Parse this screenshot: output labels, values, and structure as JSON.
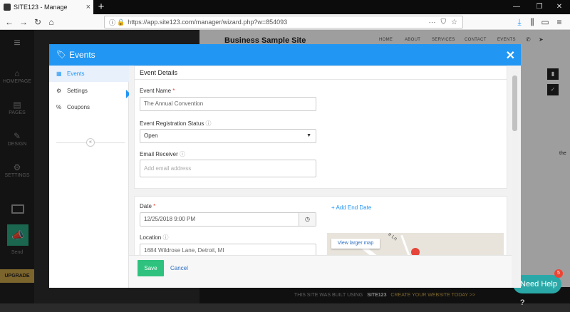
{
  "browser": {
    "tab_title": "SITE123 - Manage",
    "tab_close": "×",
    "new_tab": "+",
    "url": "https://app.site123.com/manager/wizard.php?w=854093",
    "url_menu": "···",
    "window_controls": [
      "—",
      "❐",
      "✕"
    ]
  },
  "leftnav": {
    "items": [
      {
        "label": "HOMEPAGE",
        "icon": "home-icon"
      },
      {
        "label": "PAGES",
        "icon": "pages-icon"
      },
      {
        "label": "DESIGN",
        "icon": "design-icon"
      },
      {
        "label": "SETTINGS",
        "icon": "settings-icon"
      }
    ],
    "send_label": "Send",
    "upgrade_label": "UPGRADE"
  },
  "site_preview": {
    "title": "Business Sample Site",
    "nav": [
      "HOME",
      "ABOUT",
      "SERVICES",
      "CONTACT",
      "EVENTS"
    ],
    "bottom_text": "THIS SITE WAS BUILT USING",
    "brand": "SITE123",
    "cta": "CREATE YOUR WEBSITE TODAY >>",
    "the_snippet": "the"
  },
  "help_widget": {
    "label": "Need Help ?",
    "badge": "5"
  },
  "modal": {
    "title": "Events",
    "close": "✕",
    "sidebar": [
      {
        "label": "Events",
        "icon": "tag-icon",
        "active": true
      },
      {
        "label": "Settings",
        "icon": "gear-icon",
        "active": false
      },
      {
        "label": "Coupons",
        "icon": "percent-icon",
        "active": false
      }
    ],
    "collapse_glyph": "«",
    "details": {
      "heading": "Event Details",
      "event_name_label": "Event Name",
      "event_name_value": "The Annual Convention",
      "status_label": "Event Registration Status",
      "status_value": "Open",
      "email_label": "Email Receiver",
      "email_placeholder": "Add email address"
    },
    "schedule": {
      "date_label": "Date",
      "date_value": "12/25/2018 9:00 PM",
      "add_end_date": "+ Add End Date",
      "location_label": "Location",
      "location_value": "1684 Wildrose Lane, Detroit, MI",
      "map_link": "View larger map",
      "map_street": "e Ln"
    },
    "footer": {
      "save": "Save",
      "cancel": "Cancel"
    }
  }
}
